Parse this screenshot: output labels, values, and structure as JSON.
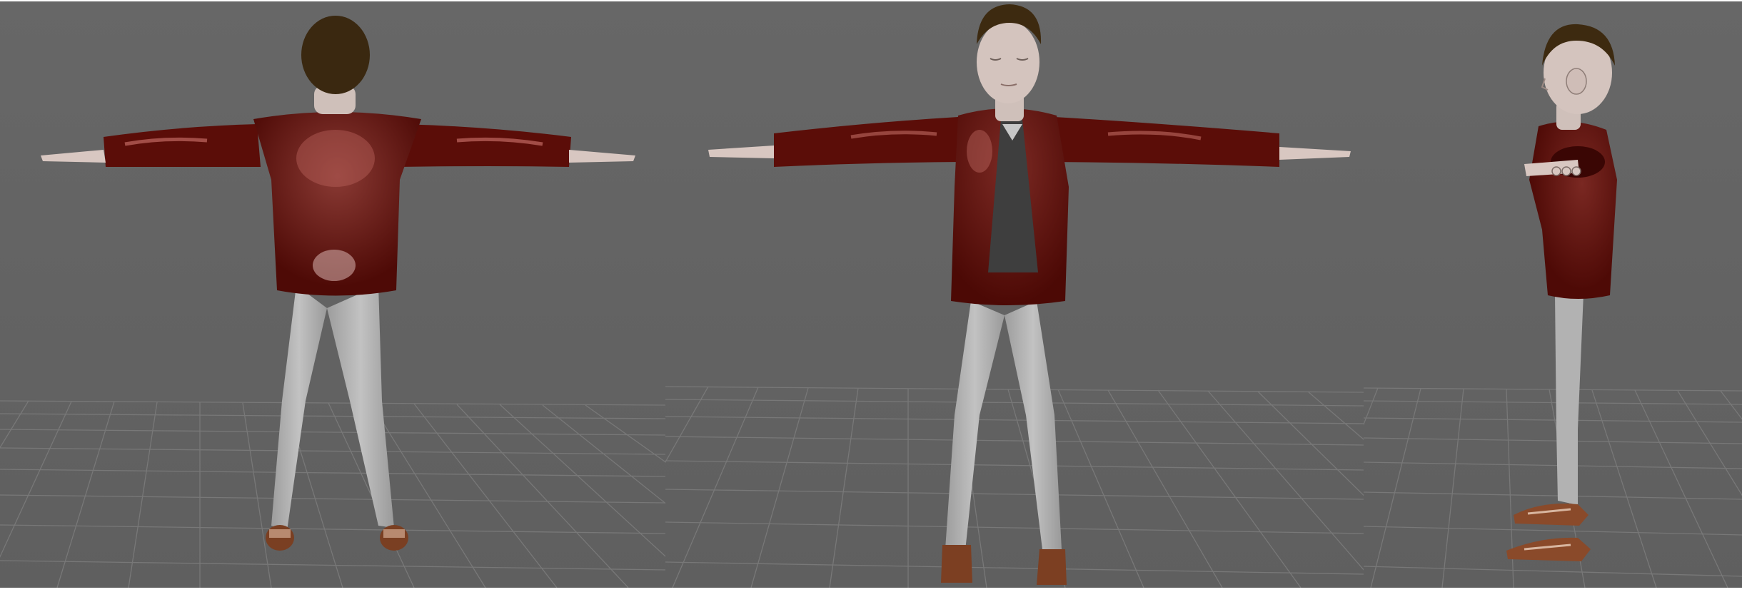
{
  "scene": {
    "views": [
      {
        "id": "back",
        "label": ""
      },
      {
        "id": "front",
        "label": ""
      },
      {
        "id": "side",
        "label": ""
      }
    ],
    "colors": {
      "background": "#666666",
      "grid_line": "#7a7a7a",
      "jacket": "#5a0c07",
      "jacket_highlight": "#b9605a",
      "pants": "#b4b4b4",
      "skin": "#d9c8c2",
      "hair": "#3d2a10",
      "shoes": "#8a4a2a",
      "shirt": "#3f3f3f"
    }
  }
}
